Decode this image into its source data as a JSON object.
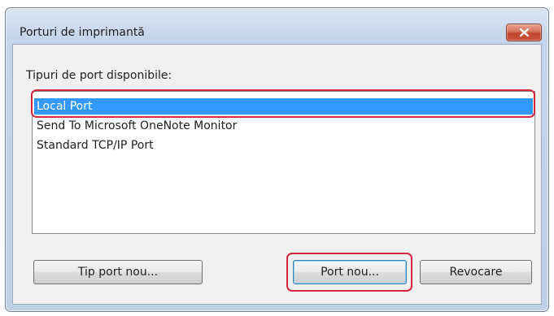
{
  "window": {
    "title": "Porturi de imprimantă",
    "close_icon": "close-x-icon"
  },
  "port_list": {
    "label": "Tipuri de port disponibile:",
    "items": [
      {
        "label": "Local Port",
        "selected": true
      },
      {
        "label": "Send To Microsoft OneNote Monitor",
        "selected": false
      },
      {
        "label": "Standard TCP/IP Port",
        "selected": false
      }
    ]
  },
  "buttons": {
    "new_port_type": "Tip port nou...",
    "new_port": "Port nou...",
    "cancel": "Revocare"
  },
  "colors": {
    "selection": "#3399ff",
    "callout": "#d6263b",
    "close_button": "#c8533b"
  }
}
